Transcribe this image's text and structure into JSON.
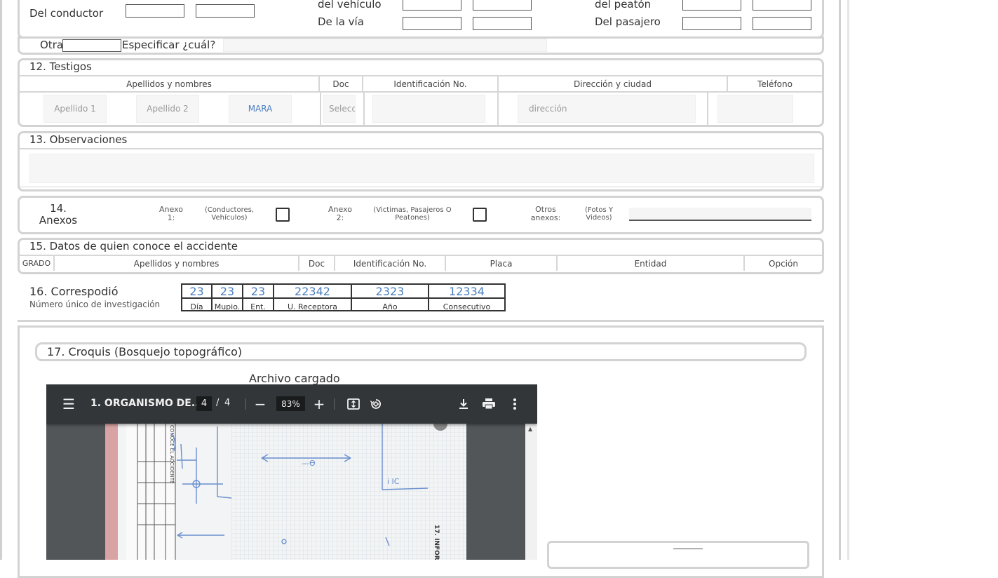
{
  "top_row": {
    "conductor_label": "Del conductor",
    "vehiculo_label": "del vehículo",
    "via_label": "De la vía",
    "peaton_label": "del peatón",
    "pasajero_label": "Del pasajero"
  },
  "otra_row": {
    "otra_label": "Otra",
    "especificar_label": "Especificar ¿cuál?"
  },
  "section12": {
    "title": "12. Testigos",
    "headers": [
      "Apellidos y nombres",
      "Doc",
      "Identificación No.",
      "Dirección y ciudad",
      "Teléfono"
    ],
    "apellido1_placeholder": "Apellido 1",
    "apellido2_placeholder": "Apellido 2",
    "nombre_value": "MARA",
    "doc_placeholder": "Selecc",
    "direccion_placeholder": "dirección"
  },
  "section13": {
    "title": "13. Observaciones"
  },
  "section14": {
    "title_line1": "14.",
    "title_line2": "Anexos",
    "anexo1_label": "Anexo 1:",
    "anexo1_desc": "(Conductores, Vehículos)",
    "anexo2_label": "Anexo 2:",
    "anexo2_desc": "(Victimas, Pasajeros O Peatones)",
    "otros_label": "Otros anexos:",
    "otros_desc": "(Fotos Y Videos)"
  },
  "section15": {
    "title": "15. Datos de quien conoce el accidente",
    "headers": [
      "GRADO",
      "Apellidos y nombres",
      "Doc",
      "Identificación No.",
      "Placa",
      "Entidad",
      "Opción"
    ]
  },
  "section16": {
    "title": "16. Correspodió",
    "subtitle": "Número único de investigación",
    "fields": [
      {
        "value": "23",
        "label": "Día"
      },
      {
        "value": "23",
        "label": "Mupio."
      },
      {
        "value": "23",
        "label": "Ent."
      },
      {
        "value": "22342",
        "label": "U. Receptora"
      },
      {
        "value": "2323",
        "label": "Año"
      },
      {
        "value": "12334",
        "label": "Consecutivo"
      }
    ]
  },
  "section17": {
    "title": "17. Croquis (Bosquejo topográfico)",
    "file_loaded_label": "Archivo cargado"
  },
  "pdf_viewer": {
    "doc_title": "1. ORGANISMO DE...",
    "current_page": "4",
    "page_separator": "/",
    "total_pages": "4",
    "zoom": "83%",
    "icons": [
      "menu-icon",
      "zoom-out-icon",
      "zoom-in-icon",
      "fit-page-icon",
      "rotate-icon",
      "download-icon",
      "print-icon",
      "more-icon"
    ],
    "sketch_text": {
      "arrow_label": "—Ө",
      "right_box_label": "i IC",
      "side_label": "17. INFOR",
      "rotated_header": "CONOCE EL ACCIDENTE"
    }
  },
  "colors": {
    "border": "#d3d3d3",
    "accent_text": "#4a7ec0",
    "pdf_toolbar": "#323639",
    "pdf_background": "#525659"
  }
}
